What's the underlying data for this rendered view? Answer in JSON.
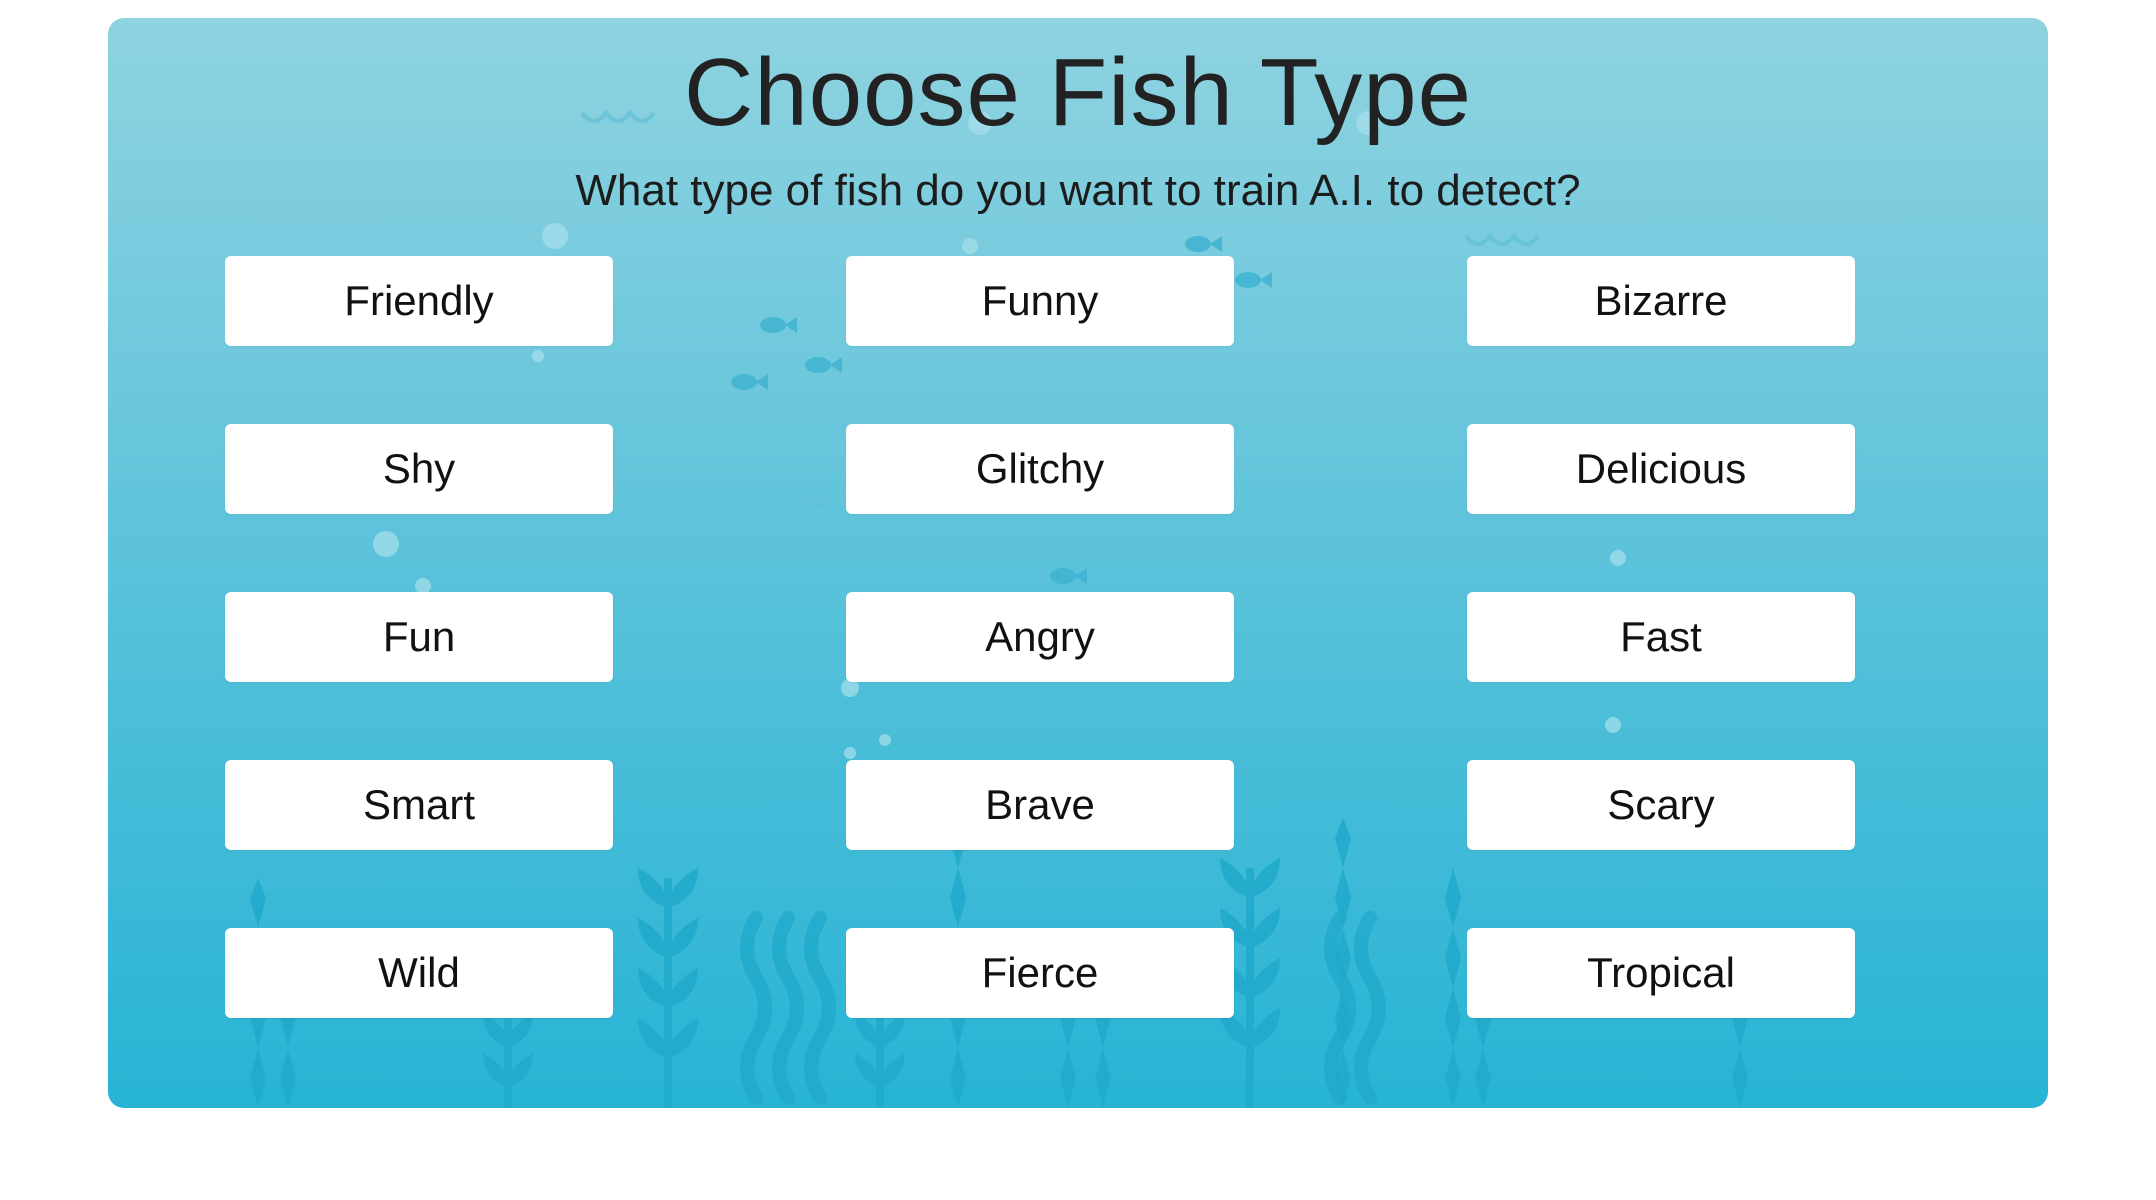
{
  "header": {
    "title": "Choose Fish Type",
    "subtitle": "What type of fish do you want to train A.I. to detect?"
  },
  "fish_types": [
    "Friendly",
    "Funny",
    "Bizarre",
    "Shy",
    "Glitchy",
    "Delicious",
    "Fun",
    "Angry",
    "Fast",
    "Smart",
    "Brave",
    "Scary",
    "Wild",
    "Fierce",
    "Tropical"
  ],
  "colors": {
    "panel_top": "#8fd3e0",
    "panel_bottom": "#27b4d5",
    "button_bg": "#ffffff",
    "text": "#222222"
  }
}
